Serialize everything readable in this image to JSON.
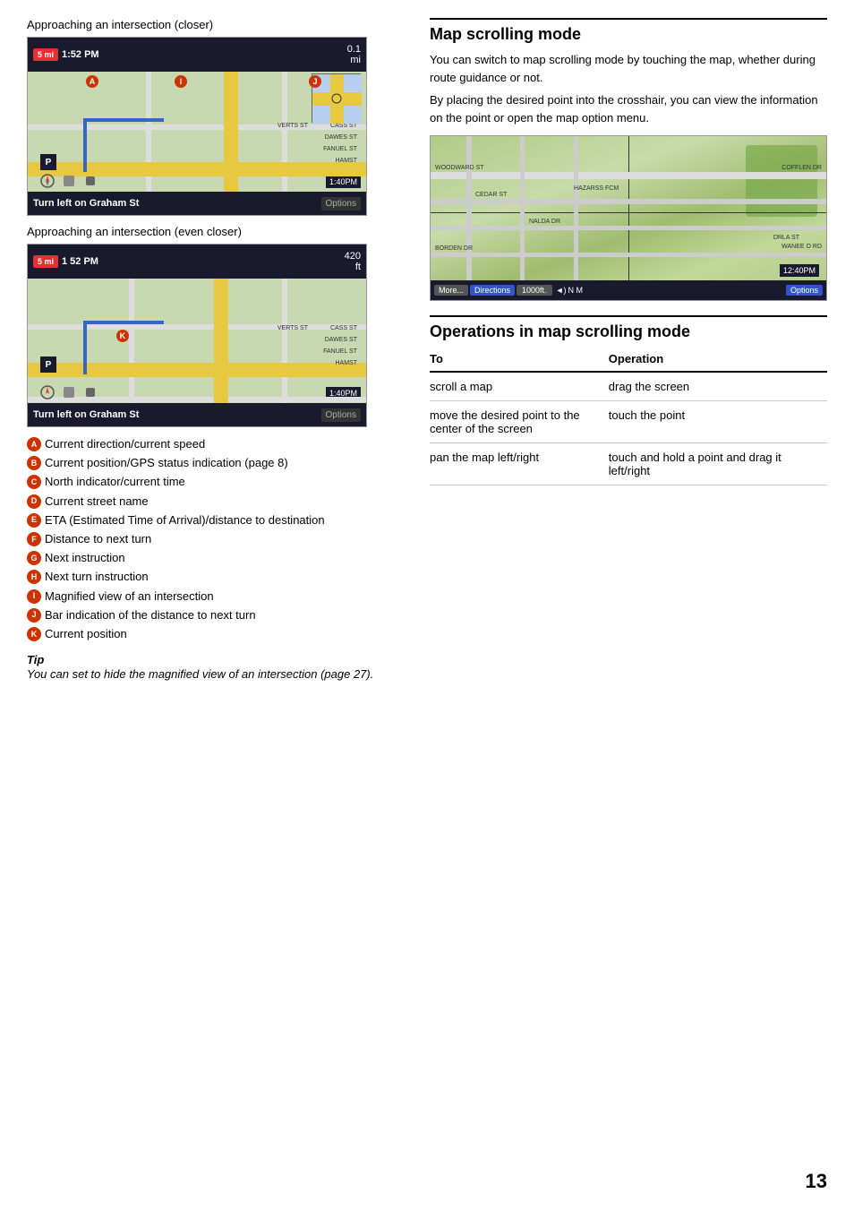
{
  "left_col": {
    "caption1": "Approaching an intersection (closer)",
    "caption2": "Approaching an intersection (even closer)",
    "map1": {
      "speed": "5 mi",
      "time": "1:52 PM",
      "dist_right": "0.1\nmi",
      "bottom_street": "Turn left on Graham St",
      "options": "Options",
      "time_overlay": "1:40PM"
    },
    "map2": {
      "speed": "5 mi",
      "time": "1 52 PM",
      "dist_right": "420\nft",
      "bottom_street": "Turn left on Graham St",
      "options": "Options",
      "time_overlay": "1:40PM"
    },
    "legend": [
      {
        "key": "A",
        "text": "Current direction/current speed"
      },
      {
        "key": "B",
        "text": "Current position/GPS status indication (page 8)"
      },
      {
        "key": "C",
        "text": "North indicator/current time"
      },
      {
        "key": "D",
        "text": "Current street name"
      },
      {
        "key": "E",
        "text": "ETA (Estimated Time of Arrival)/distance to destination"
      },
      {
        "key": "F",
        "text": "Distance to next turn"
      },
      {
        "key": "G",
        "text": "Next instruction"
      },
      {
        "key": "H",
        "text": "Next turn instruction"
      },
      {
        "key": "I",
        "text": "Magnified view of an intersection"
      },
      {
        "key": "J",
        "text": "Bar indication of the distance to next turn"
      },
      {
        "key": "K",
        "text": "Current position"
      }
    ],
    "tip": {
      "label": "Tip",
      "text": "You can set to hide the magnified view of an intersection (page 27)."
    }
  },
  "right_col": {
    "map_scrolling_title": "Map scrolling mode",
    "map_scrolling_desc1": "You can switch to map scrolling mode by touching the map, whether during route guidance or not.",
    "map_scrolling_desc2": "By placing the desired point into the crosshair, you can view the information on the point or open the map option menu.",
    "scroll_map": {
      "time_overlay": "12:40PM",
      "btn_more": "More...",
      "btn_directions": "Directions",
      "btn_dist": "1000ft.",
      "btn_options": "Options",
      "streets": [
        "WOODWARD ST",
        "COFFLEN DR",
        "CEDAR ST",
        "BORDEN DR",
        "NALDA DR",
        "DRLA ST",
        "HAZARSS FCM",
        "WANEE O RD"
      ]
    },
    "ops_title": "Operations in map scrolling mode",
    "ops_table": {
      "col1": "To",
      "col2": "Operation",
      "rows": [
        {
          "to": "scroll a map",
          "op": "drag the screen"
        },
        {
          "to": "move the desired point to the center of the screen",
          "op": "touch the point"
        },
        {
          "to": "pan the map left/right",
          "op": "touch and hold a point and drag it left/right"
        }
      ]
    }
  },
  "page_number": "13"
}
